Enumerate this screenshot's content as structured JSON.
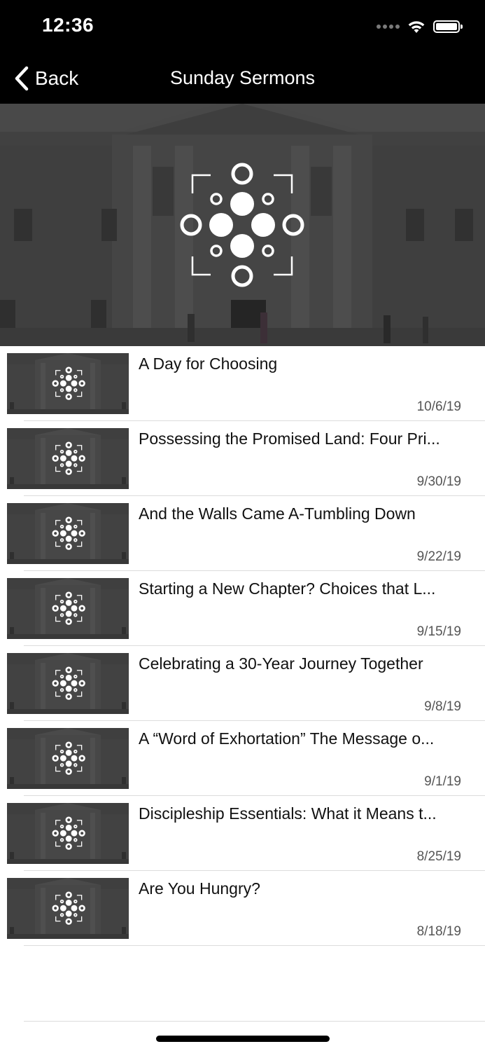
{
  "status_bar": {
    "time": "12:36"
  },
  "nav": {
    "back_label": "Back",
    "title": "Sunday Sermons"
  },
  "sermons": [
    {
      "title": "A Day for Choosing",
      "date": "10/6/19"
    },
    {
      "title": "Possessing the Promised Land: Four Pri...",
      "date": "9/30/19"
    },
    {
      "title": "And the Walls Came A-Tumbling Down",
      "date": "9/22/19"
    },
    {
      "title": "Starting a New Chapter? Choices that L...",
      "date": "9/15/19"
    },
    {
      "title": "Celebrating a 30-Year Journey Together",
      "date": "9/8/19"
    },
    {
      "title": "A “Word of Exhortation” The Message o...",
      "date": "9/1/19"
    },
    {
      "title": "Discipleship Essentials: What it Means t...",
      "date": "8/25/19"
    },
    {
      "title": "Are You Hungry?",
      "date": "8/18/19"
    }
  ],
  "icons": {
    "back": "chevron-left-icon",
    "wifi": "wifi-icon",
    "battery": "battery-icon",
    "logo": "church-logo"
  },
  "colors": {
    "nav_background": "#000000",
    "text_primary": "#111111",
    "date_text": "#555555"
  }
}
